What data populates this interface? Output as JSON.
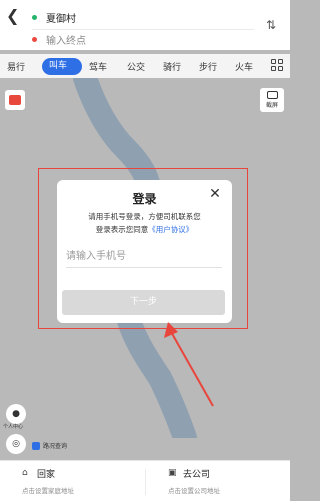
{
  "header": {
    "start": "夏御村",
    "end_placeholder": "输入终点"
  },
  "modes": [
    "易行",
    "叫车",
    "驾车",
    "公交",
    "骑行",
    "步行",
    "火车"
  ],
  "active_mode": "叫车",
  "corner_right_label": "截屏",
  "dialog": {
    "title": "登录",
    "desc_line1": "请用手机号登录，方便司机联系您",
    "desc_line2": "登录表示您同意",
    "agreement": "《用户协议》",
    "phone_placeholder": "请输入手机号",
    "next_button": "下一步"
  },
  "side": {
    "profile_label": "个人中心",
    "traffic": "路况查询"
  },
  "bottom": {
    "home_title": "回家",
    "home_sub": "点击设置家庭地址",
    "work_title": "去公司",
    "work_sub": "点击设置公司地址"
  },
  "colors": {
    "accent": "#2f6fe6",
    "highlight": "#e8453c"
  }
}
